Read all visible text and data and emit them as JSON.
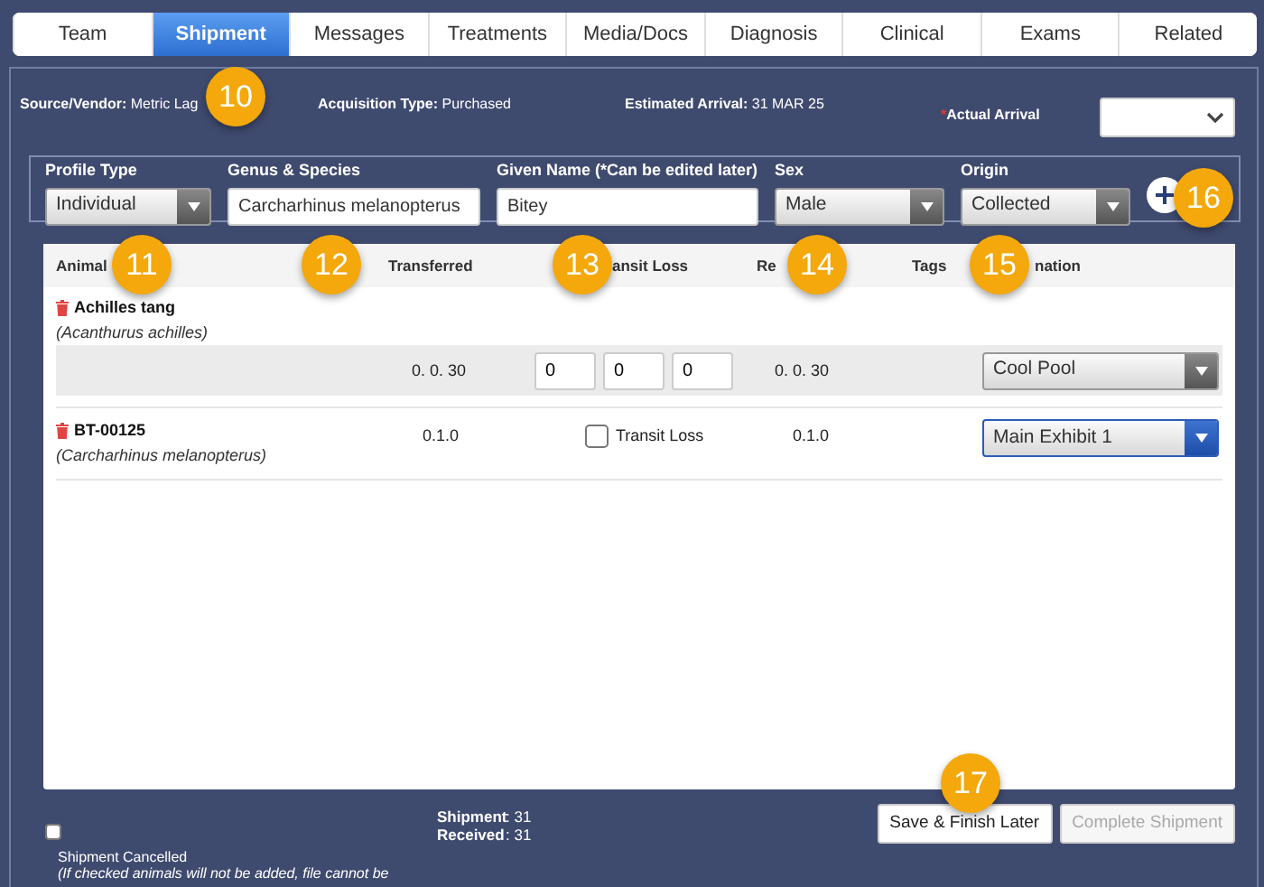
{
  "tabs": [
    {
      "label": "Team",
      "selected": false
    },
    {
      "label": "Shipment",
      "selected": true
    },
    {
      "label": "Messages",
      "selected": false
    },
    {
      "label": "Treatments",
      "selected": false
    },
    {
      "label": "Media/Docs",
      "selected": false
    },
    {
      "label": "Diagnosis",
      "selected": false
    },
    {
      "label": "Clinical",
      "selected": false
    },
    {
      "label": "Exams",
      "selected": false
    },
    {
      "label": "Related",
      "selected": false
    }
  ],
  "info": {
    "source_label": "Source/Vendor:",
    "source_value": "Metric Lag",
    "acquisition_label": "Acquisition Type:",
    "acquisition_value": "Purchased",
    "estimated_label": "Estimated Arrival:",
    "estimated_value": "31 MAR 25",
    "required_mark": "*",
    "actual_label": "Actual Arrival"
  },
  "filters": [
    {
      "label": "Profile Type",
      "kind": "select",
      "value": "Individual"
    },
    {
      "label": "Genus & Species",
      "kind": "text",
      "value": "Carcharhinus melanopterus"
    },
    {
      "label": "Given Name (*Can be edited later)",
      "kind": "text",
      "value": "Bitey"
    },
    {
      "label": "Sex",
      "kind": "select",
      "value": "Male"
    },
    {
      "label": "Origin",
      "kind": "select",
      "value": "Collected"
    }
  ],
  "table": {
    "columns": [
      "Animal",
      "Transferred",
      "ansit Loss",
      "Re",
      "Tags",
      "nation"
    ],
    "rows": [
      {
        "kind": "group",
        "name": "Achilles tang",
        "species": "(Acanthurus achilles)",
        "transferred": "0. 0. 30",
        "loss": [
          "0",
          "0",
          "0"
        ],
        "received": "0. 0. 30",
        "destination": "Cool Pool",
        "focused": false
      },
      {
        "kind": "single",
        "name": "BT-00125",
        "species": "(Carcharhinus melanopterus)",
        "transferred": "0.1.0",
        "loss_label": "Transit Loss",
        "loss_checked": false,
        "received": "0.1.0",
        "destination": "Main Exhibit 1",
        "focused": true
      }
    ]
  },
  "footer": {
    "cancel_checked": false,
    "cancel_label": "Shipment Cancelled",
    "cancel_note": "(If checked animals will not be added, file cannot be",
    "totals": [
      {
        "label": "Shipment",
        "separator": ":",
        "value": "31"
      },
      {
        "label": "Received",
        "separator": ":",
        "value": "31"
      }
    ],
    "buttons": [
      {
        "label": "Save & Finish Later",
        "disabled": false
      },
      {
        "label": "Complete Shipment",
        "disabled": true
      }
    ]
  },
  "callouts": [
    "10",
    "11",
    "12",
    "13",
    "14",
    "15",
    "16",
    "17"
  ]
}
